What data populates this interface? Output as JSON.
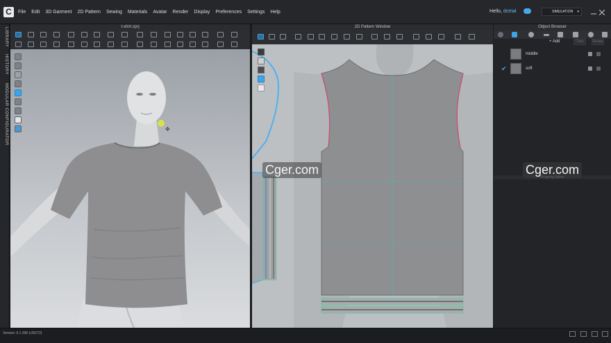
{
  "app": {
    "logo_letter": "C"
  },
  "menu": [
    "File",
    "Edit",
    "3D Garment",
    "2D Pattern",
    "Sewing",
    "Materials",
    "Avatar",
    "Render",
    "Display",
    "Preferences",
    "Settings",
    "Help"
  ],
  "user": {
    "greeting": "Hello,",
    "name": "dctrial"
  },
  "mode": {
    "label": "SIMULATION"
  },
  "side_tabs": [
    "LIBRARY",
    "HISTORY",
    "MODULAR CONFIGURATOR"
  ],
  "viewport3d": {
    "title": "t-shirt.zprj"
  },
  "pattern2d": {
    "title": "2D Pattern Window"
  },
  "object_browser": {
    "title": "Object Browser",
    "add_label": "+ Add",
    "btn_copy": "Copy",
    "btn_assign": "Assign",
    "fabrics": [
      {
        "name": "middle",
        "selected": false
      },
      {
        "name": "soft",
        "selected": true
      }
    ]
  },
  "property_editor": {
    "title": "Property Editor"
  },
  "status": {
    "version": "Version: 6.1.396 (r35272)"
  },
  "watermarks": [
    "Cger.com",
    "Cger.com"
  ],
  "colors": {
    "accent": "#3fa4ea",
    "garment": "#8e8e90",
    "pattern_bg": "#bdc0c3"
  }
}
